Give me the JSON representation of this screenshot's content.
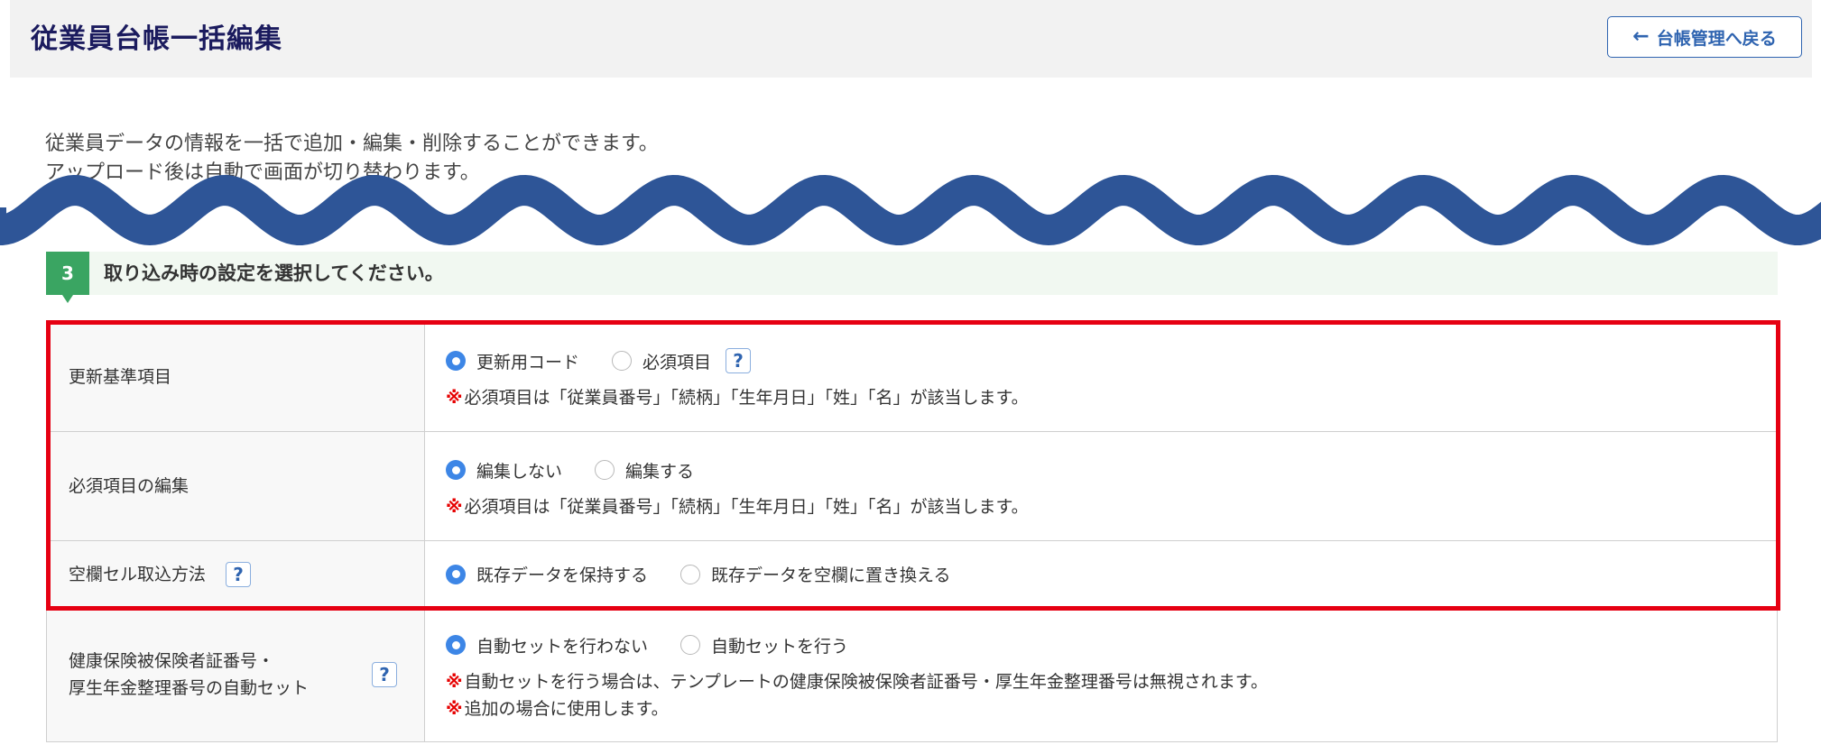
{
  "header": {
    "title": "従業員台帳一括編集",
    "back_button": {
      "label": "台帳管理へ戻る",
      "icon": "arrow-left-icon"
    }
  },
  "description": [
    "従業員データの情報を一括で追加・編集・削除することができます。",
    "アップロード後は自動で画面が切り替わります。"
  ],
  "step": {
    "number": "3",
    "label": "取り込み時の設定を選択してください。"
  },
  "settings": [
    {
      "label": [
        "更新基準項目"
      ],
      "options": [
        "更新用コード",
        "必須項目"
      ],
      "selected": 0,
      "help": true,
      "notes": [
        "必須項目は「従業員番号」「続柄」「生年月日」「姓」「名」が該当します。"
      ]
    },
    {
      "label": [
        "必須項目の編集"
      ],
      "options": [
        "編集しない",
        "編集する"
      ],
      "selected": 0,
      "notes": [
        "必須項目は「従業員番号」「続柄」「生年月日」「姓」「名」が該当します。"
      ]
    },
    {
      "label": [
        "空欄セル取込方法"
      ],
      "label_help": true,
      "options": [
        "既存データを保持する",
        "既存データを空欄に置き換える"
      ],
      "selected": 0,
      "notes": []
    },
    {
      "label": [
        "健康保険被保険者証番号・",
        "厚生年金整理番号の自動セット"
      ],
      "label_help": true,
      "options": [
        "自動セットを行わない",
        "自動セットを行う"
      ],
      "selected": 0,
      "notes": [
        "自動セットを行う場合は、テンプレートの健康保険被保険者証番号・厚生年金整理番号は無視されます。",
        "追加の場合に使用します。"
      ]
    }
  ],
  "note_mark": "※",
  "help_glyph": "?",
  "colors": {
    "title": "#1b1b5e",
    "accent": "#2f64b0",
    "step_badge": "#3aa562",
    "radio_checked": "#3d86e6",
    "note_mark": "#e60000",
    "highlight": "#e60012",
    "wave": "#2e5597"
  }
}
